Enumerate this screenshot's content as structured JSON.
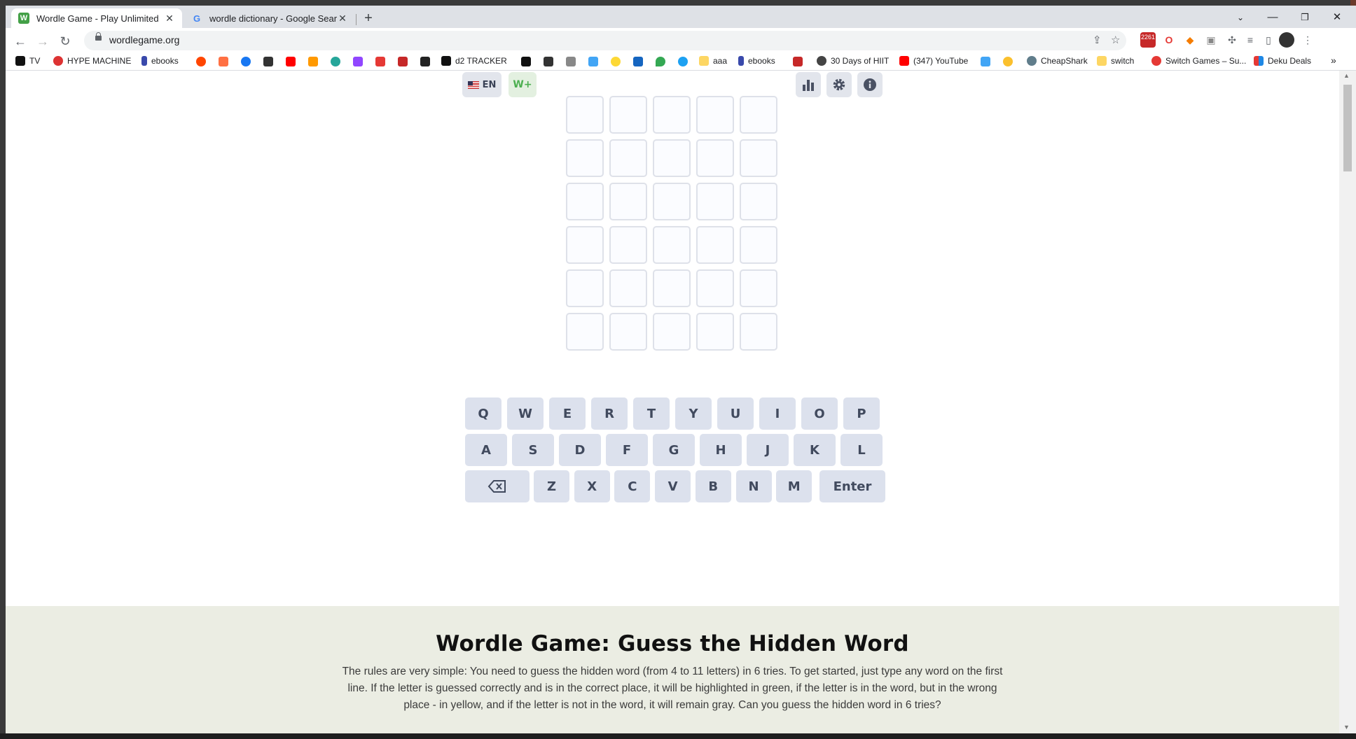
{
  "browser": {
    "tabs": [
      {
        "title": "Wordle Game - Play Unlimited",
        "favicon": "W",
        "active": true
      },
      {
        "title": "wordle dictionary - Google Search",
        "favicon": "G",
        "active": false
      }
    ],
    "url": "wordlegame.org",
    "extension_badge": "2261",
    "bookmarks": [
      "TV",
      "HYPE MACHINE",
      "ebooks",
      "d2 TRACKER",
      "aaa",
      "ebooks",
      "30 Days of HIIT",
      "(347) YouTube",
      "CheapShark",
      "switch",
      "Switch Games – Su...",
      "Deku Deals"
    ],
    "overflow_label": "»"
  },
  "game": {
    "language_label": "EN",
    "wplus_label": "W+",
    "rows": 6,
    "cols": 5,
    "keyboard": {
      "row1": [
        "Q",
        "W",
        "E",
        "R",
        "T",
        "Y",
        "U",
        "I",
        "O",
        "P"
      ],
      "row2": [
        "A",
        "S",
        "D",
        "F",
        "G",
        "H",
        "J",
        "K",
        "L"
      ],
      "row3": [
        "Z",
        "X",
        "C",
        "V",
        "B",
        "N",
        "M"
      ],
      "enter_label": "Enter"
    }
  },
  "info": {
    "title": "Wordle Game: Guess the Hidden Word",
    "text": "The rules are very simple: You need to guess the hidden word (from 4 to 11 letters) in 6 tries. To get started, just type any word on the first line. If the letter is guessed correctly and is in the correct place, it will be highlighted in green, if the letter is in the word, but in the wrong place - in yellow, and if the letter is not in the word, it will remain gray. Can you guess the hidden word in 6 tries?"
  },
  "colors": {
    "accent_green": "#4caf50",
    "key_bg": "#dce1ed",
    "info_bg": "#ebede3"
  }
}
